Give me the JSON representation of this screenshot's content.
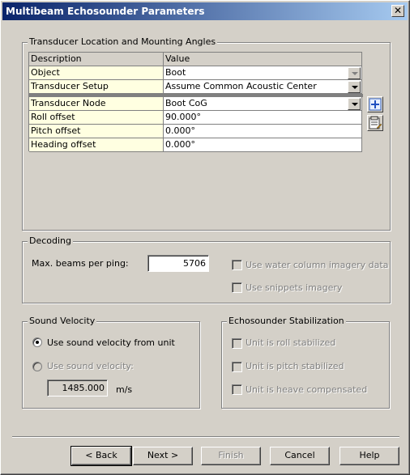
{
  "window": {
    "title": "Multibeam Echosounder Parameters",
    "close_glyph": "✕"
  },
  "transducer": {
    "legend": "Transducer Location and Mounting Angles",
    "header": {
      "description": "Description",
      "value": "Value"
    },
    "rows": [
      {
        "description": "Object",
        "value": "Boot"
      },
      {
        "description": "Transducer Setup",
        "value": "Assume Common Acoustic Center"
      },
      {
        "description": "Transducer Node",
        "value": "Boot CoG"
      },
      {
        "description": "Roll offset",
        "value": "90.000°"
      },
      {
        "description": "Pitch offset",
        "value": "0.000°"
      },
      {
        "description": "Heading offset",
        "value": "0.000°"
      }
    ]
  },
  "decoding": {
    "legend": "Decoding",
    "max_beams_label": "Max.  beams per ping:",
    "max_beams_value": "5706",
    "water_column_label": "Use water column imagery data",
    "snippets_label": "Use snippets imagery"
  },
  "sound_velocity": {
    "legend": "Sound Velocity",
    "use_from_unit_label": "Use sound velocity from unit",
    "use_sound_velocity_label": "Use sound velocity:",
    "value": "1485.000",
    "unit": "m/s"
  },
  "stabilization": {
    "legend": "Echosounder Stabilization",
    "roll_label": "Unit is roll stabilized",
    "pitch_label": "Unit is pitch stabilized",
    "heave_label": "Unit is heave compensated"
  },
  "buttons": {
    "back": "< Back",
    "next": "Next >",
    "finish": "Finish",
    "cancel": "Cancel",
    "help": "Help"
  },
  "colors": {
    "title_start": "#0a246a",
    "title_end": "#a6caf0",
    "key_cell_bg": "#ffffe1",
    "face": "#d4d0c8"
  }
}
